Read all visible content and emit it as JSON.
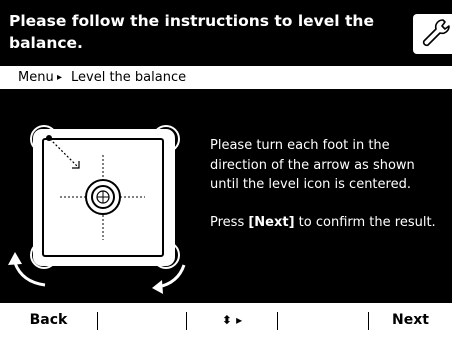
{
  "header": {
    "title": "Please follow the instructions to level the balance.",
    "settings_icon": "wrench-icon"
  },
  "breadcrumb": {
    "root": "Menu",
    "separator": "▸",
    "current": "Level the balance"
  },
  "instructions": {
    "line1": "Please turn each foot in the direction of the arrow as shown until the level icon is centered.",
    "line2_prefix": "Press ",
    "line2_key": "[Next]",
    "line2_suffix": " to confirm the result."
  },
  "illustration": {
    "icons": [
      "balance-top-view",
      "level-bubble-icon",
      "rotate-left-arrow-icon",
      "rotate-right-arrow-icon"
    ]
  },
  "softkeys": {
    "back": "Back",
    "key2": "",
    "nav": "⬍ ▸",
    "key4": "",
    "next": "Next"
  },
  "colors": {
    "background": "#000000",
    "foreground": "#ffffff"
  }
}
